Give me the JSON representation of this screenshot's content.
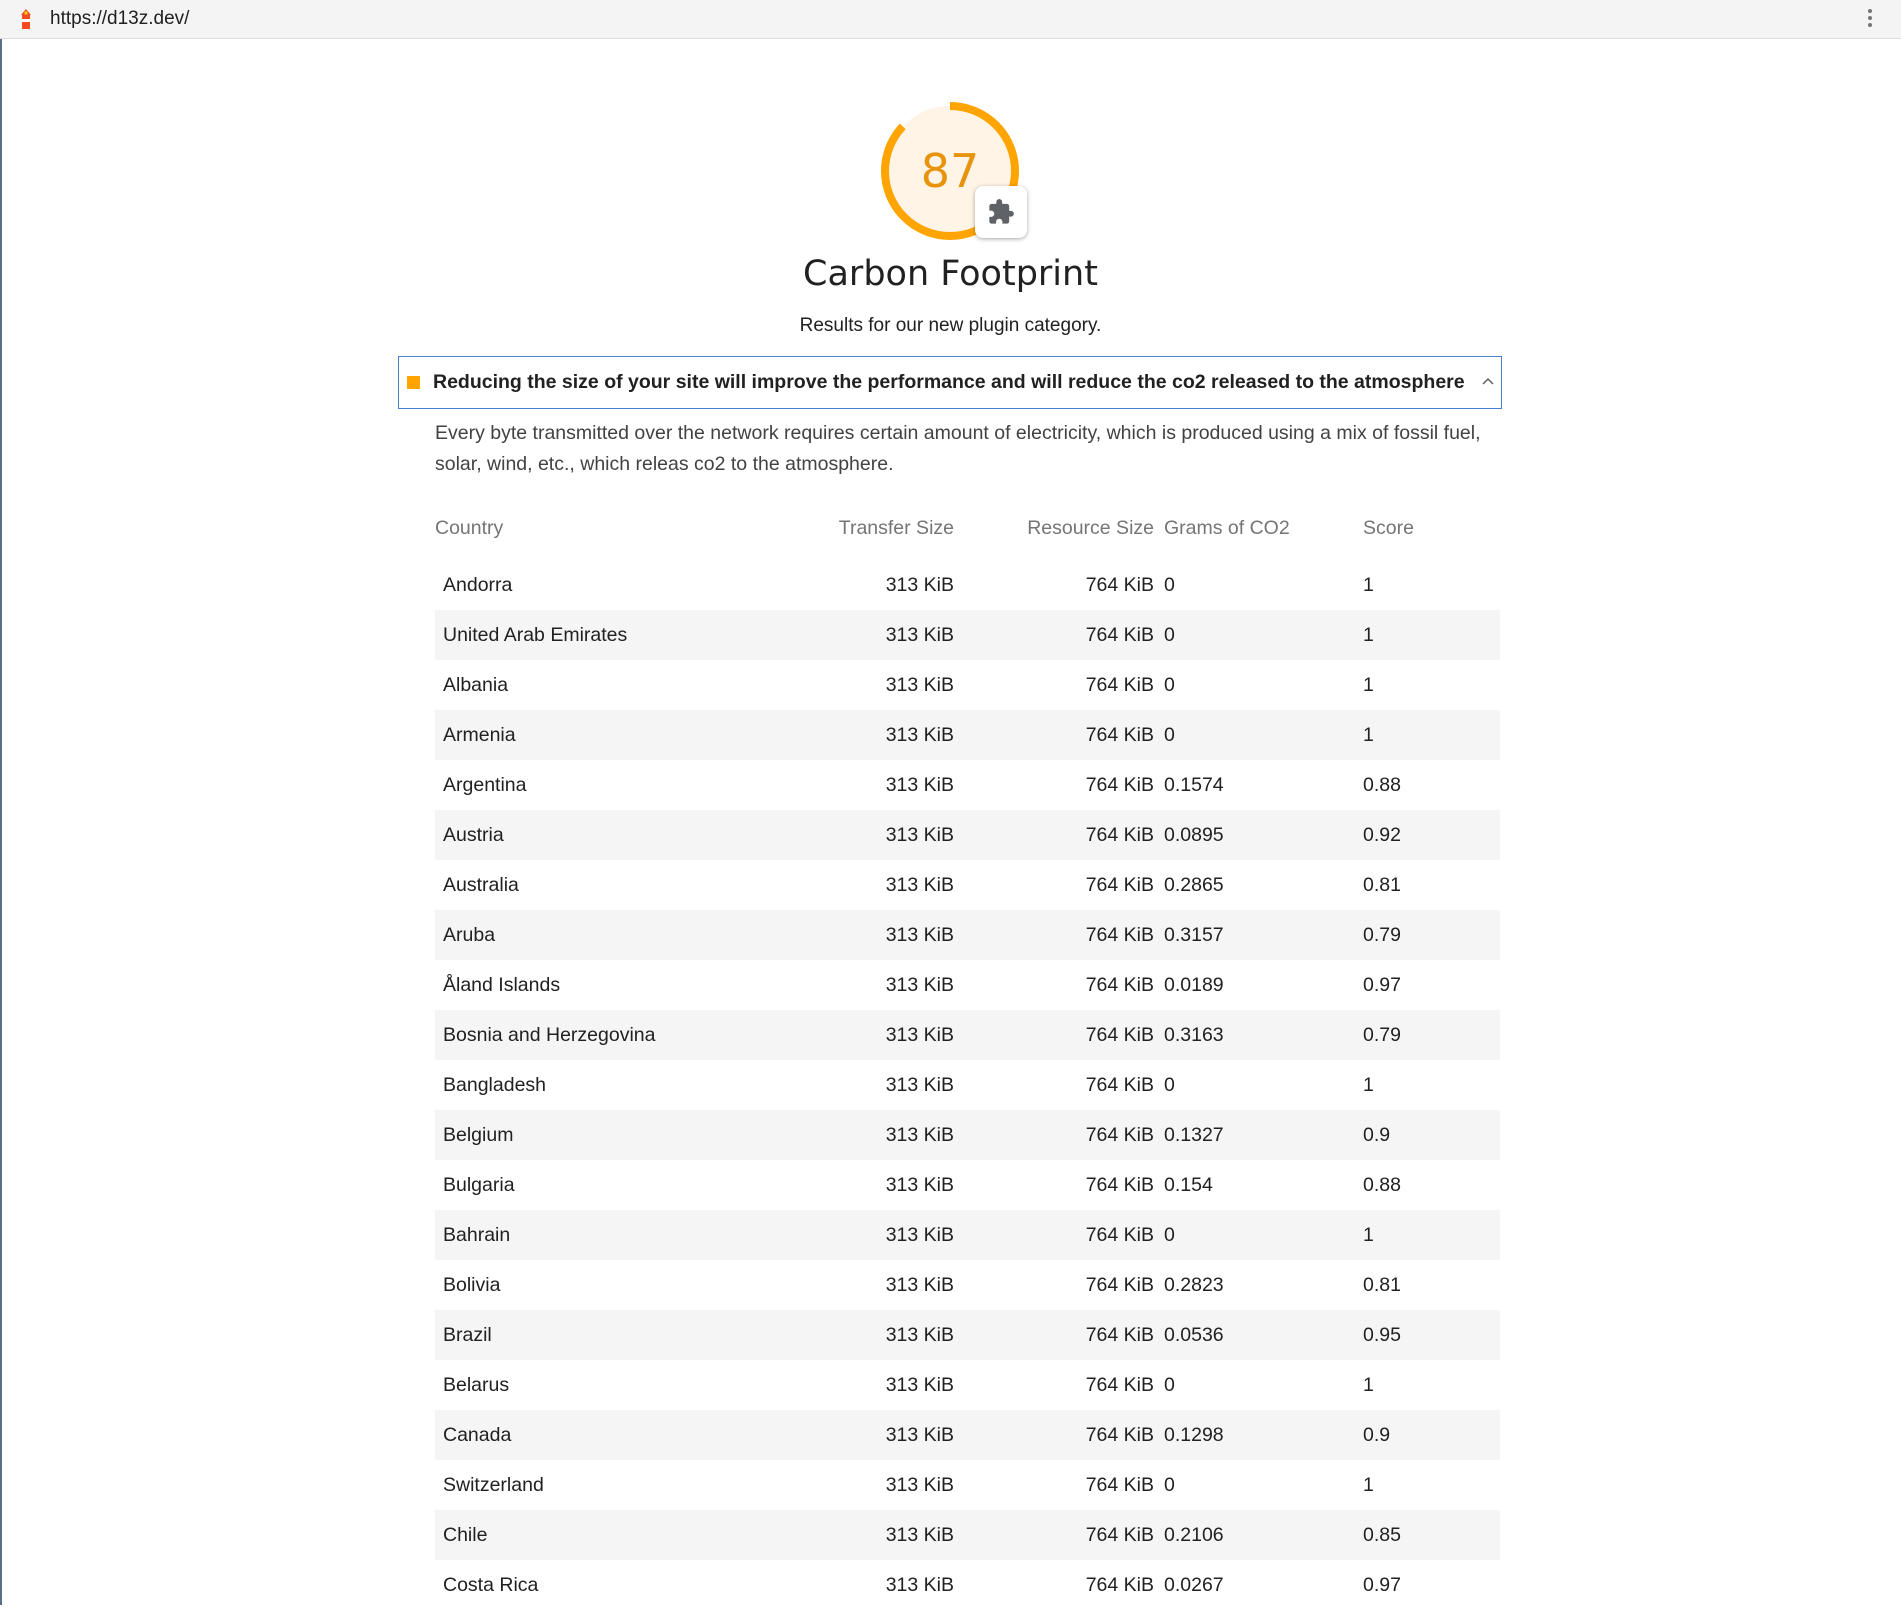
{
  "browser": {
    "url": "https://d13z.dev/"
  },
  "gauge": {
    "score": "87",
    "fraction": 0.87,
    "color": "#ffa400"
  },
  "category": {
    "title": "Carbon Footprint",
    "description": "Results for our new plugin category."
  },
  "audit": {
    "title": "Reducing the size of your site will improve the performance and will reduce the co2 released to the atmosphere",
    "description": "Every byte transmitted over the network requires certain amount of electricity, which is produced using a mix of fossil fuel, solar, wind, etc., which releas co2 to the atmosphere."
  },
  "table": {
    "headers": {
      "country": "Country",
      "transfer": "Transfer Size",
      "resource": "Resource Size",
      "co2": "Grams of CO2",
      "score": "Score"
    },
    "rows": [
      {
        "country": "Andorra",
        "transfer": "313 KiB",
        "resource": "764 KiB",
        "co2": "0",
        "score": "1"
      },
      {
        "country": "United Arab Emirates",
        "transfer": "313 KiB",
        "resource": "764 KiB",
        "co2": "0",
        "score": "1"
      },
      {
        "country": "Albania",
        "transfer": "313 KiB",
        "resource": "764 KiB",
        "co2": "0",
        "score": "1"
      },
      {
        "country": "Armenia",
        "transfer": "313 KiB",
        "resource": "764 KiB",
        "co2": "0",
        "score": "1"
      },
      {
        "country": "Argentina",
        "transfer": "313 KiB",
        "resource": "764 KiB",
        "co2": "0.1574",
        "score": "0.88"
      },
      {
        "country": "Austria",
        "transfer": "313 KiB",
        "resource": "764 KiB",
        "co2": "0.0895",
        "score": "0.92"
      },
      {
        "country": "Australia",
        "transfer": "313 KiB",
        "resource": "764 KiB",
        "co2": "0.2865",
        "score": "0.81"
      },
      {
        "country": "Aruba",
        "transfer": "313 KiB",
        "resource": "764 KiB",
        "co2": "0.3157",
        "score": "0.79"
      },
      {
        "country": "Åland Islands",
        "transfer": "313 KiB",
        "resource": "764 KiB",
        "co2": "0.0189",
        "score": "0.97"
      },
      {
        "country": "Bosnia and Herzegovina",
        "transfer": "313 KiB",
        "resource": "764 KiB",
        "co2": "0.3163",
        "score": "0.79"
      },
      {
        "country": "Bangladesh",
        "transfer": "313 KiB",
        "resource": "764 KiB",
        "co2": "0",
        "score": "1"
      },
      {
        "country": "Belgium",
        "transfer": "313 KiB",
        "resource": "764 KiB",
        "co2": "0.1327",
        "score": "0.9"
      },
      {
        "country": "Bulgaria",
        "transfer": "313 KiB",
        "resource": "764 KiB",
        "co2": "0.154",
        "score": "0.88"
      },
      {
        "country": "Bahrain",
        "transfer": "313 KiB",
        "resource": "764 KiB",
        "co2": "0",
        "score": "1"
      },
      {
        "country": "Bolivia",
        "transfer": "313 KiB",
        "resource": "764 KiB",
        "co2": "0.2823",
        "score": "0.81"
      },
      {
        "country": "Brazil",
        "transfer": "313 KiB",
        "resource": "764 KiB",
        "co2": "0.0536",
        "score": "0.95"
      },
      {
        "country": "Belarus",
        "transfer": "313 KiB",
        "resource": "764 KiB",
        "co2": "0",
        "score": "1"
      },
      {
        "country": "Canada",
        "transfer": "313 KiB",
        "resource": "764 KiB",
        "co2": "0.1298",
        "score": "0.9"
      },
      {
        "country": "Switzerland",
        "transfer": "313 KiB",
        "resource": "764 KiB",
        "co2": "0",
        "score": "1"
      },
      {
        "country": "Chile",
        "transfer": "313 KiB",
        "resource": "764 KiB",
        "co2": "0.2106",
        "score": "0.85"
      },
      {
        "country": "Costa Rica",
        "transfer": "313 KiB",
        "resource": "764 KiB",
        "co2": "0.0267",
        "score": "0.97"
      }
    ]
  }
}
